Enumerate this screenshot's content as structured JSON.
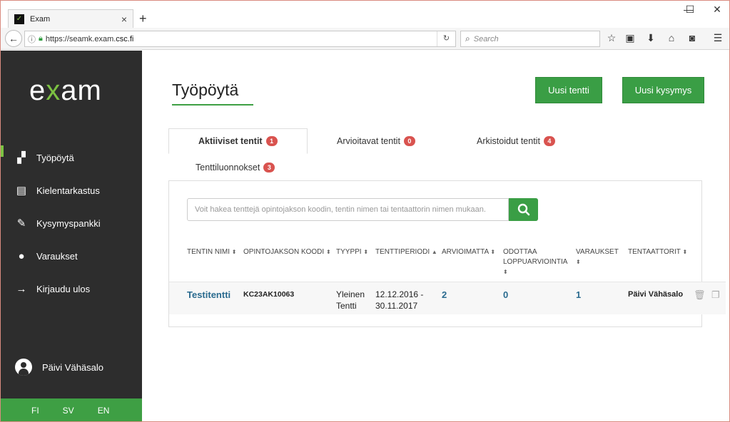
{
  "browser": {
    "tab_title": "Exam",
    "tab_close": "×",
    "new_tab": "+",
    "url_scheme": "https://seamk.exam.",
    "url_domain": "csc.fi",
    "search_placeholder": "Search",
    "window_controls": [
      "—",
      "☐",
      "✕"
    ]
  },
  "sidebar": {
    "logo_e": "e",
    "logo_x": "x",
    "logo_am": "am",
    "items": [
      {
        "label": "Työpöytä",
        "icon": "dashboard-icon",
        "glyph": "▞",
        "active": true
      },
      {
        "label": "Kielentarkastus",
        "icon": "book-icon",
        "glyph": "▤",
        "active": false
      },
      {
        "label": "Kysymyspankki",
        "icon": "pencil-icon",
        "glyph": "✎",
        "active": false
      },
      {
        "label": "Varaukset",
        "icon": "user-icon",
        "glyph": "●",
        "active": false
      },
      {
        "label": "Kirjaudu ulos",
        "icon": "arrow-right-icon",
        "glyph": "→",
        "active": false
      }
    ],
    "user_name": "Päivi Vähäsalo",
    "languages": [
      "FI",
      "SV",
      "EN"
    ]
  },
  "main": {
    "title": "Työpöytä",
    "new_exam_button": "Uusi tentti",
    "new_question_button": "Uusi kysymys",
    "tabs": [
      {
        "label": "Aktiiviset tentit",
        "count": "1"
      },
      {
        "label": "Arvioitavat tentit",
        "count": "0"
      },
      {
        "label": "Arkistoidut tentit",
        "count": "4"
      },
      {
        "label": "Tenttiluonnokset",
        "count": "3"
      }
    ],
    "search_placeholder": "Voit hakea tenttejä opintojakson koodin, tentin nimen tai tentaattorin nimen mukaan.",
    "table": {
      "headers": [
        "TENTIN NIMI",
        "OPINTOJAKSON KOODI",
        "TYYPPI",
        "TENTTIPERIODI",
        "ARVIOIMATTA",
        "ODOTTAA",
        "LOPPUARVIOINTIA",
        "VARAUKSET",
        "TENTAATTORIT"
      ],
      "row": {
        "name": "Testitentti",
        "code": "KC23AK10063",
        "type_line1": "Yleinen",
        "type_line2": "Tentti",
        "period_line1": "12.12.2016 -",
        "period_line2": "30.11.2017",
        "unreviewed": "2",
        "awaiting": "0",
        "reservations": "1",
        "examiner": "Päivi Vähäsalo"
      }
    }
  },
  "colors": {
    "accent": "#3a9e45",
    "sidebar": "#2d2d2d",
    "badge": "#d9534f",
    "link": "#2a6b8f"
  }
}
